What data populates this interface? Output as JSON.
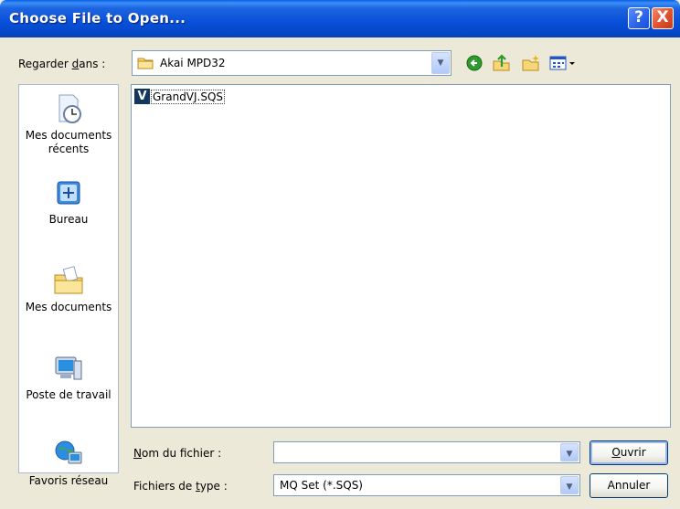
{
  "window": {
    "title": "Choose File to Open..."
  },
  "titlebar_buttons": {
    "help": "?",
    "close": "X"
  },
  "lookin": {
    "label_prefix": "Regarder ",
    "label_accel": "d",
    "label_suffix": "ans :",
    "value": "Akai MPD32",
    "arrow": "▼"
  },
  "toolbar": [
    "back-icon",
    "up-folder-icon",
    "new-folder-icon",
    "view-menu-icon"
  ],
  "places": [
    {
      "label": "Mes documents récents",
      "icon": "recent-documents-icon"
    },
    {
      "label": "Bureau",
      "icon": "desktop-icon"
    },
    {
      "label": "Mes documents",
      "icon": "my-documents-icon"
    },
    {
      "label": "Poste de travail",
      "icon": "my-computer-icon"
    },
    {
      "label": "Favoris réseau",
      "icon": "network-places-icon"
    }
  ],
  "files": [
    {
      "name": "GrandVJ.SQS",
      "icon_letter": "V"
    }
  ],
  "filename_field": {
    "label_accel": "N",
    "label_rest": "om du fichier :",
    "value": "",
    "arrow": "▼"
  },
  "filetype_field": {
    "label_prefix": "Fichiers de ",
    "label_accel": "t",
    "label_suffix": "ype :",
    "value": "MQ Set (*.SQS)",
    "arrow": "▼"
  },
  "buttons": {
    "open_accel": "O",
    "open_rest": "uvrir",
    "cancel": "Annuler"
  },
  "colors": {
    "titlebar": "#0750d8",
    "dialog_bg": "#ece9d8",
    "border": "#7f9db9"
  }
}
